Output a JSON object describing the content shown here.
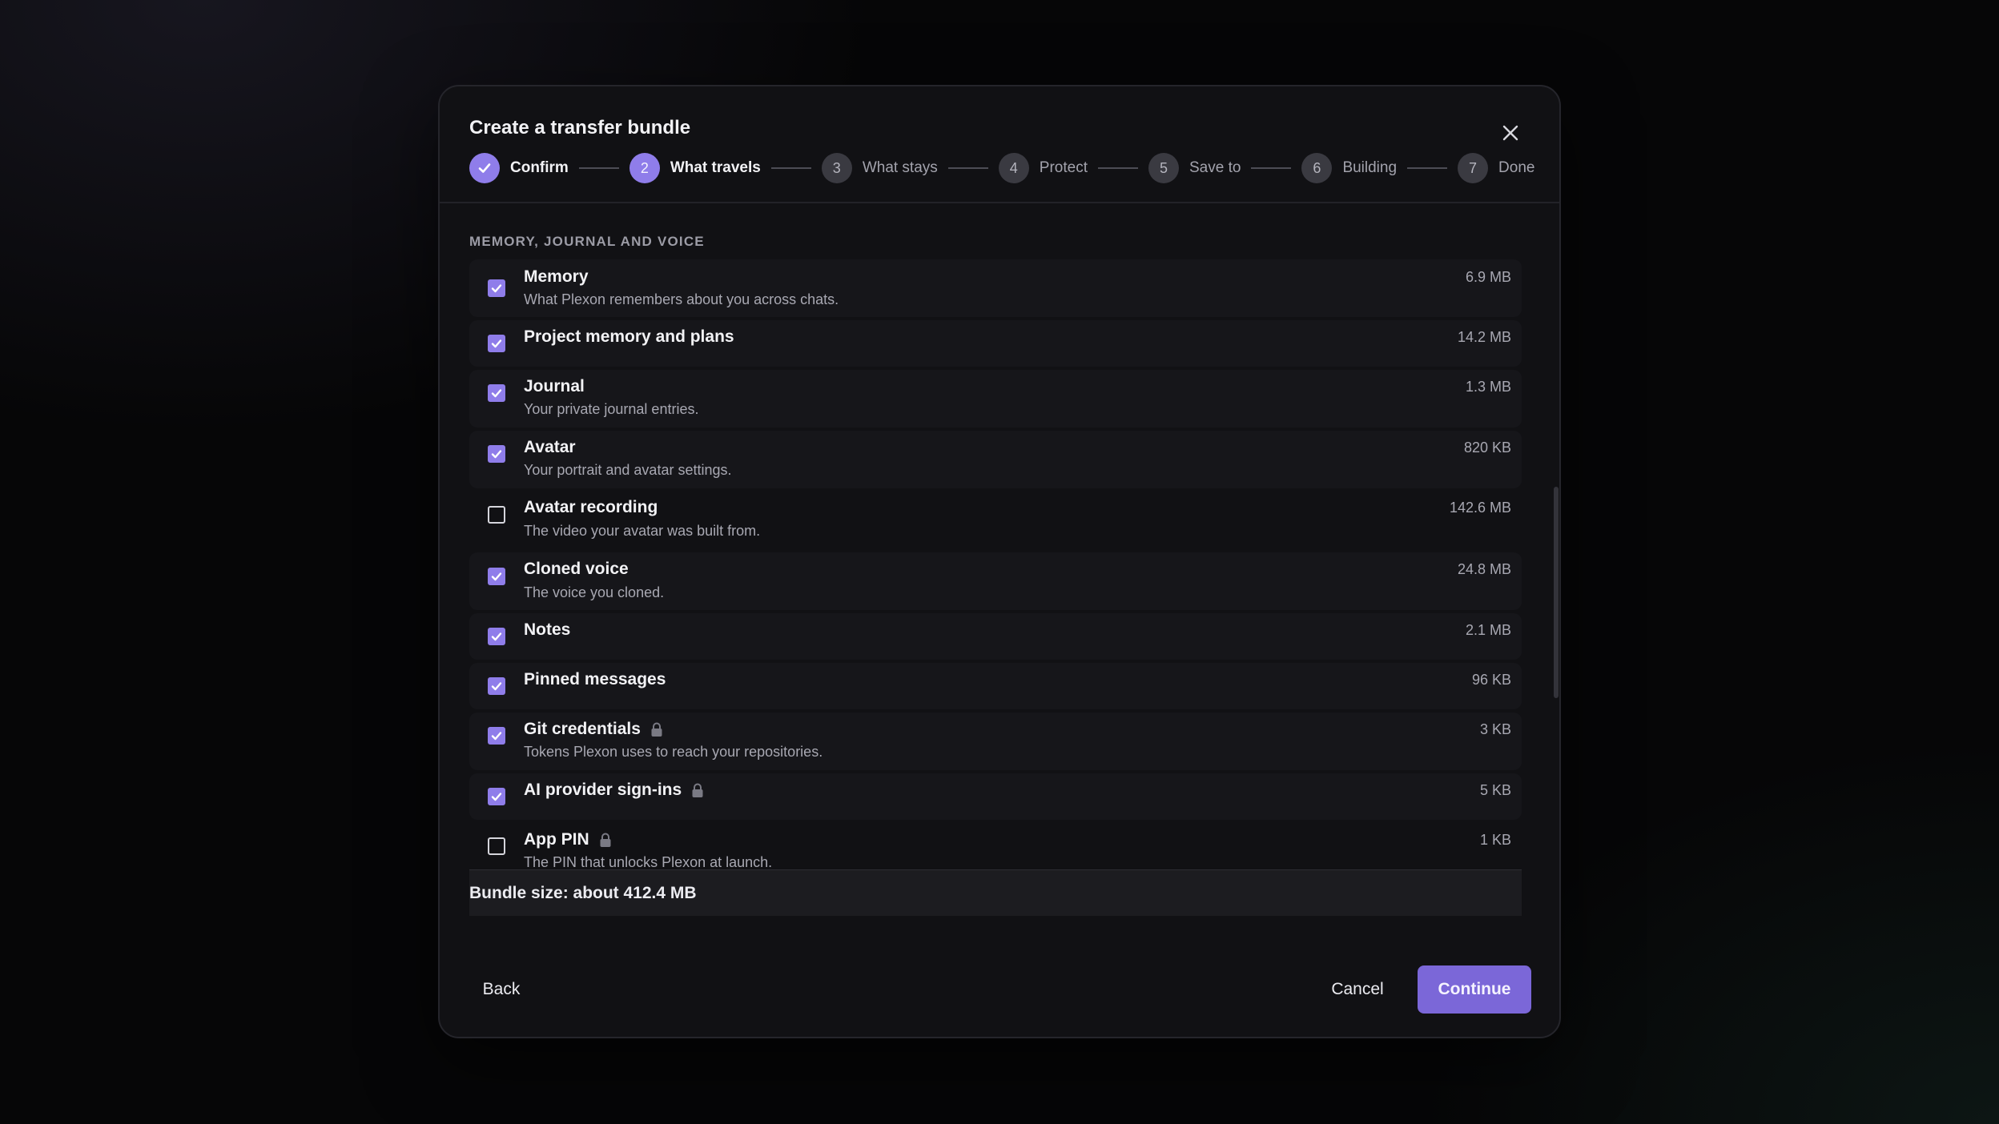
{
  "dialog": {
    "title": "Create a transfer bundle",
    "close_icon": "close-icon"
  },
  "steps": [
    {
      "number": "",
      "label": "Confirm",
      "state": "done"
    },
    {
      "number": "2",
      "label": "What travels",
      "state": "active"
    },
    {
      "number": "3",
      "label": "What stays",
      "state": "upcoming"
    },
    {
      "number": "4",
      "label": "Protect",
      "state": "upcoming"
    },
    {
      "number": "5",
      "label": "Save to",
      "state": "upcoming"
    },
    {
      "number": "6",
      "label": "Building",
      "state": "upcoming"
    },
    {
      "number": "7",
      "label": "Done",
      "state": "upcoming"
    }
  ],
  "section": {
    "heading": "MEMORY, JOURNAL AND VOICE",
    "items": [
      {
        "name": "Memory",
        "description": "What Plexon remembers about you across chats.",
        "size": "6.9 MB",
        "checked": true,
        "locked": false
      },
      {
        "name": "Project memory and plans",
        "description": "",
        "size": "14.2 MB",
        "checked": true,
        "locked": false
      },
      {
        "name": "Journal",
        "description": "Your private journal entries.",
        "size": "1.3 MB",
        "checked": true,
        "locked": false
      },
      {
        "name": "Avatar",
        "description": "Your portrait and avatar settings.",
        "size": "820 KB",
        "checked": true,
        "locked": false
      },
      {
        "name": "Avatar recording",
        "description": "The video your avatar was built from.",
        "size": "142.6 MB",
        "checked": false,
        "locked": false
      },
      {
        "name": "Cloned voice",
        "description": "The voice you cloned.",
        "size": "24.8 MB",
        "checked": true,
        "locked": false
      },
      {
        "name": "Notes",
        "description": "",
        "size": "2.1 MB",
        "checked": true,
        "locked": false
      },
      {
        "name": "Pinned messages",
        "description": "",
        "size": "96 KB",
        "checked": true,
        "locked": false
      },
      {
        "name": "Git credentials",
        "description": "Tokens Plexon uses to reach your repositories.",
        "size": "3 KB",
        "checked": true,
        "locked": true
      },
      {
        "name": "AI provider sign-ins",
        "description": "",
        "size": "5 KB",
        "checked": true,
        "locked": true
      },
      {
        "name": "App PIN",
        "description": "The PIN that unlocks Plexon at launch.",
        "size": "1 KB",
        "checked": false,
        "locked": true
      }
    ]
  },
  "bundle": {
    "size_text": "Bundle size: about 412.4 MB"
  },
  "footer": {
    "back_label": "Back",
    "cancel_label": "Cancel",
    "continue_label": "Continue"
  },
  "colors": {
    "accent": "#8f7dea",
    "primary_button": "#7b67d8",
    "dialog_bg": "#111114"
  }
}
